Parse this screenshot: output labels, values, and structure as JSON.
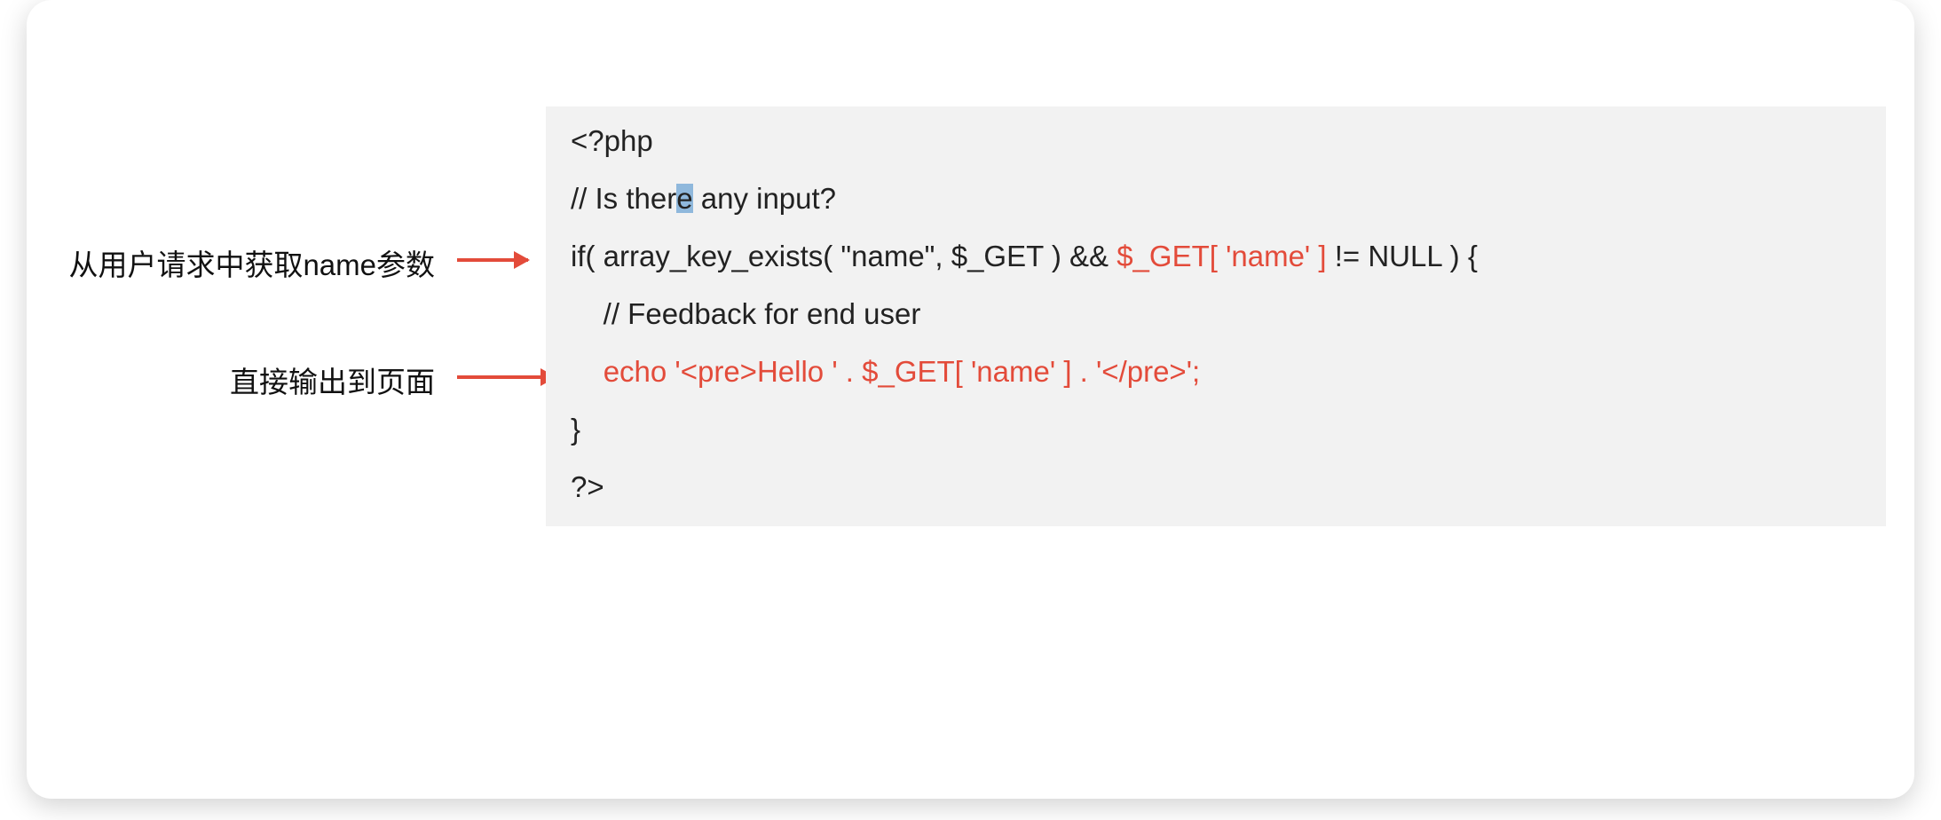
{
  "annotations": {
    "ann1": "从用户请求中获取name参数",
    "ann2": "直接输出到页面"
  },
  "code": {
    "l1": "<?php",
    "l2_pre": "// Is ther",
    "l2_hl": "e",
    "l2_post": " any input?",
    "l3_a": "if( array_key_exists( \"name\", $_GET ) && ",
    "l3_red": "$_GET[ 'name' ]",
    "l3_b": " != NULL ) {",
    "l4": "    // Feedback for end user",
    "l5_indent": "    ",
    "l5_red": "echo '<pre>Hello ' . $_GET[ 'name' ] . '</pre>';",
    "l6": "}",
    "l7": "?>"
  }
}
